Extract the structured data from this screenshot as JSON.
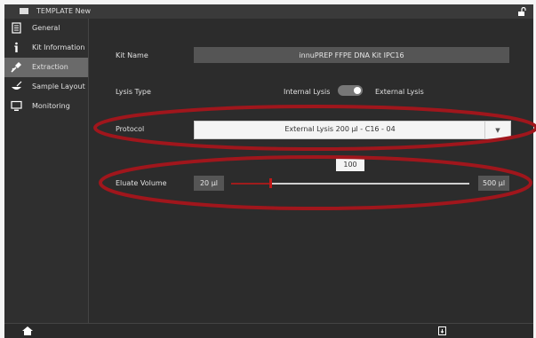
{
  "window": {
    "title": "TEMPLATE New"
  },
  "sidebar": {
    "items": [
      {
        "label": "General",
        "icon": "document-icon",
        "active": false
      },
      {
        "label": "Kit Information",
        "icon": "info-icon",
        "active": false
      },
      {
        "label": "Extraction",
        "icon": "pipette-icon",
        "active": true
      },
      {
        "label": "Sample Layout",
        "icon": "bowl-icon",
        "active": false
      },
      {
        "label": "Monitoring",
        "icon": "monitor-icon",
        "active": false
      }
    ]
  },
  "form": {
    "kit_name": {
      "label": "Kit Name",
      "value": "innuPREP FFPE DNA Kit IPC16"
    },
    "lysis_type": {
      "label": "Lysis Type",
      "option_left": "Internal Lysis",
      "option_right": "External Lysis",
      "selected": "External Lysis"
    },
    "protocol": {
      "label": "Protocol",
      "value": "External Lysis 200 µl - C16 - 04",
      "arrow": "▼"
    },
    "eluate_volume": {
      "label": "Eluate Volume",
      "min_label": "20 µl",
      "max_label": "500 µl",
      "min": 20,
      "max": 500,
      "value": 100,
      "value_label": "100"
    }
  },
  "colors": {
    "annotation": "#a0161c",
    "background": "#2c2c2c",
    "active_nav": "#6a6a6a"
  }
}
